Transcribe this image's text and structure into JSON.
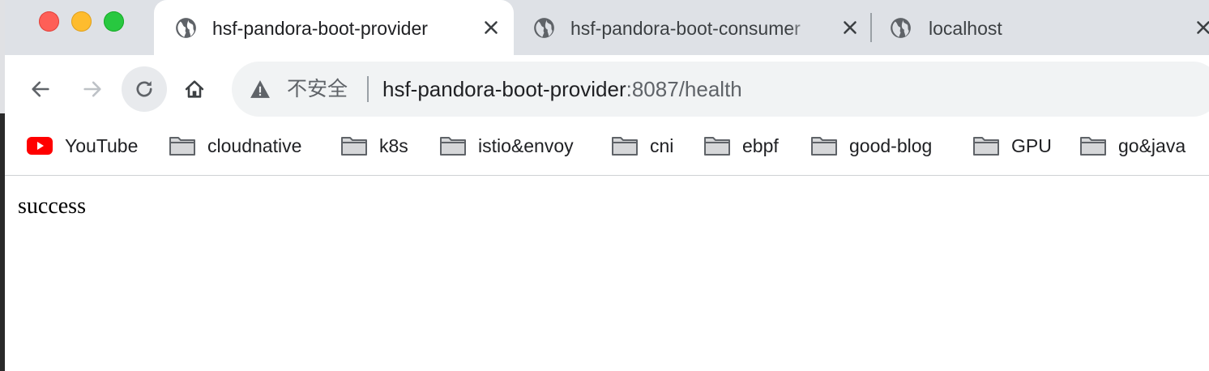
{
  "window": {
    "controls": [
      "close",
      "minimize",
      "maximize"
    ],
    "colors": {
      "close": "#fe5f57",
      "minimize": "#febc2e",
      "maximize": "#28c840"
    }
  },
  "tabs": [
    {
      "title": "hsf-pandora-boot-provider",
      "icon": "globe-icon",
      "active": true
    },
    {
      "title": "hsf-pandora-boot-consumer",
      "icon": "globe-icon",
      "active": false
    },
    {
      "title": "localhost",
      "icon": "globe-icon",
      "active": false
    }
  ],
  "toolbar": {
    "back_icon": "arrow-left-icon",
    "forward_icon": "arrow-right-icon",
    "reload_icon": "reload-icon",
    "home_icon": "home-icon"
  },
  "omnibox": {
    "security_icon": "warning-icon",
    "security_label": "不安全",
    "url_host": "hsf-pandora-boot-provider",
    "url_rest": ":8087/health"
  },
  "bookmarks": [
    {
      "label": "YouTube",
      "icon": "youtube-icon"
    },
    {
      "label": "cloudnative",
      "icon": "folder-icon"
    },
    {
      "label": "k8s",
      "icon": "folder-icon"
    },
    {
      "label": "istio&envoy",
      "icon": "folder-icon"
    },
    {
      "label": "cni",
      "icon": "folder-icon"
    },
    {
      "label": "ebpf",
      "icon": "folder-icon"
    },
    {
      "label": "good-blog",
      "icon": "folder-icon"
    },
    {
      "label": "GPU",
      "icon": "folder-icon"
    },
    {
      "label": "go&java",
      "icon": "folder-icon"
    }
  ],
  "page": {
    "body_text": "success"
  }
}
